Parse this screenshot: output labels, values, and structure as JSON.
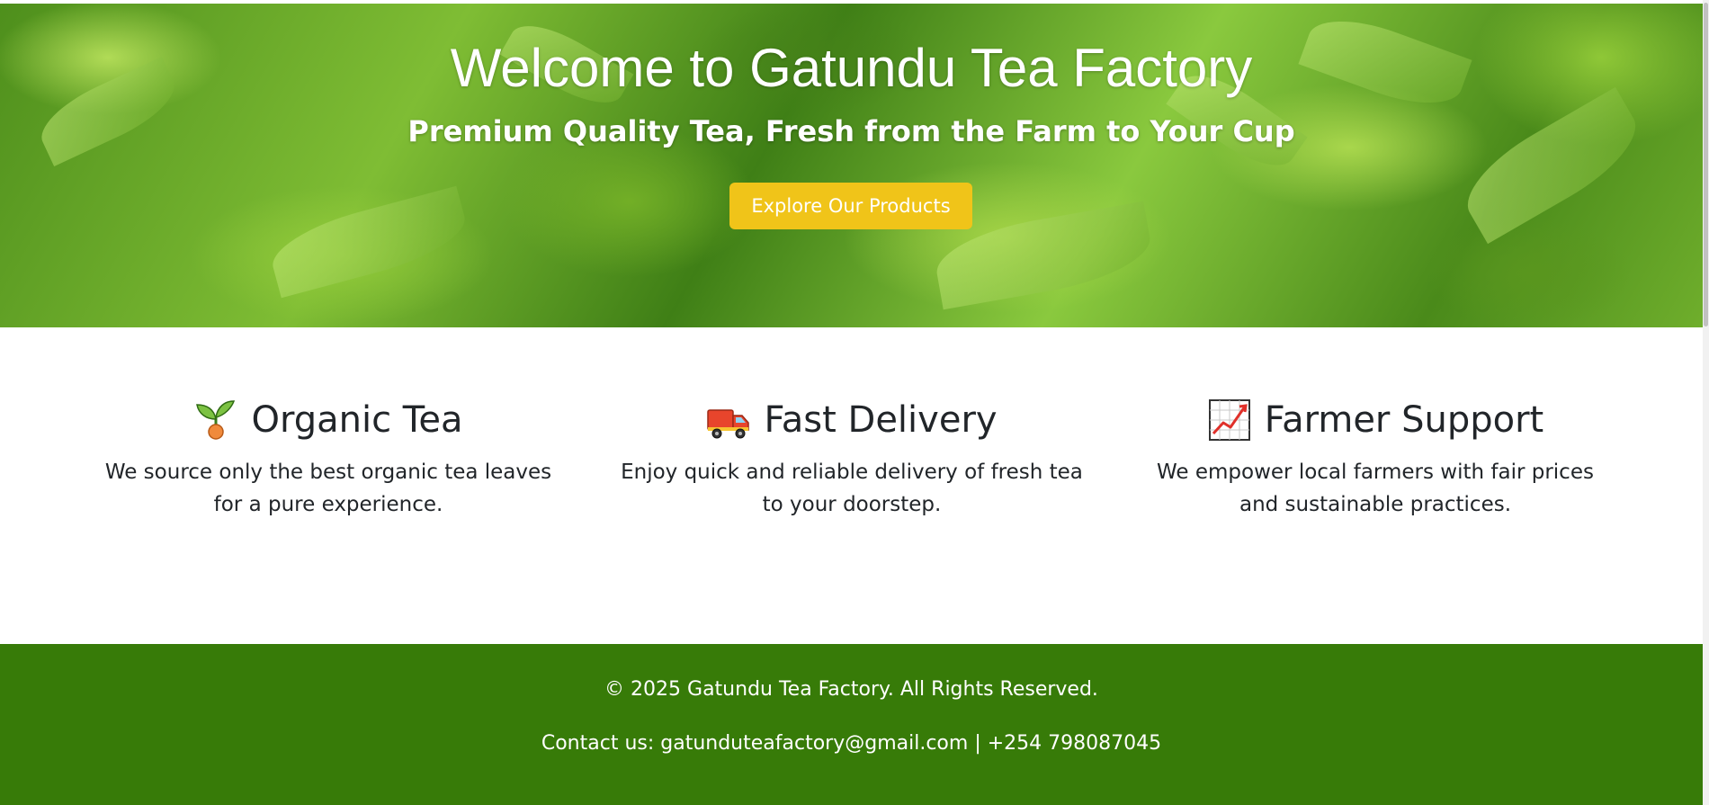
{
  "hero": {
    "title": "Welcome to Gatundu Tea Factory",
    "subtitle": "Premium Quality Tea, Fresh from the Farm to Your Cup",
    "cta_label": "Explore Our Products",
    "cta_color": "#f0c419"
  },
  "features": [
    {
      "icon": "seedling-icon",
      "title": "Organic Tea",
      "text": "We source only the best organic tea leaves for a pure experience."
    },
    {
      "icon": "delivery-truck-icon",
      "title": "Fast Delivery",
      "text": "Enjoy quick and reliable delivery of fresh tea to your doorstep."
    },
    {
      "icon": "chart-increasing-icon",
      "title": "Farmer Support",
      "text": "We empower local farmers with fair prices and sustainable practices."
    }
  ],
  "footer": {
    "copyright": "© 2025 Gatundu Tea Factory. All Rights Reserved.",
    "contact": "Contact us: gatunduteafactory@gmail.com | +254 798087045",
    "background_color": "#377b08"
  }
}
